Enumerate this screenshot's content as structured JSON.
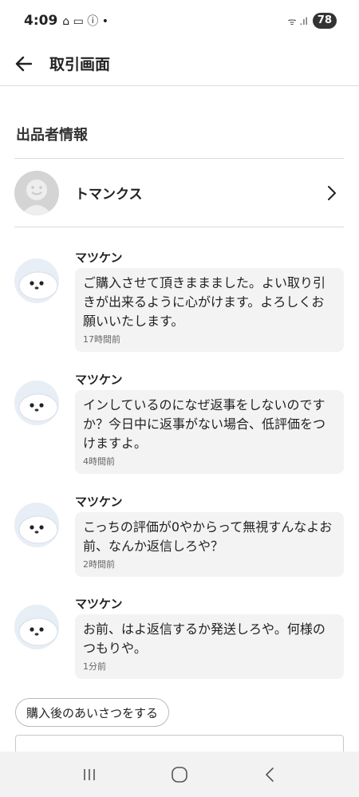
{
  "status_bar": {
    "time": "4:09",
    "indicators": "⌂ ▭ ⓘ •",
    "signal": "ᯤ .ıl",
    "battery": "78"
  },
  "app_bar": {
    "title": "取引画面",
    "back_icon": "arrow-left-icon"
  },
  "seller_section": {
    "title": "出品者情報",
    "seller_name": "トマンクス"
  },
  "messages": [
    {
      "sender": "マツケン",
      "text": "ご購入させて頂きままました。よい取り引きが出来るように心がけます。よろしくお願いいたします。",
      "time": "17時間前"
    },
    {
      "sender": "マツケン",
      "text": "インしているのになぜ返事をしないのですか？今日中に返事がない場合、低評価をつけますよ。",
      "time": "4時間前"
    },
    {
      "sender": "マツケン",
      "text": "こっちの評価が0やからって無視すんなよお前、なんか返信しろや？",
      "time": "2時間前"
    },
    {
      "sender": "マツケン",
      "text": "お前、はよ返信するか発送しろや。何様のつもりや。",
      "time": "1分前"
    }
  ],
  "greeting_button": "購入後のあいさつをする",
  "colors": {
    "bubble": "#f3f3f3",
    "divider": "#dcdcdc",
    "nav_bar": "#f2f2f2"
  }
}
